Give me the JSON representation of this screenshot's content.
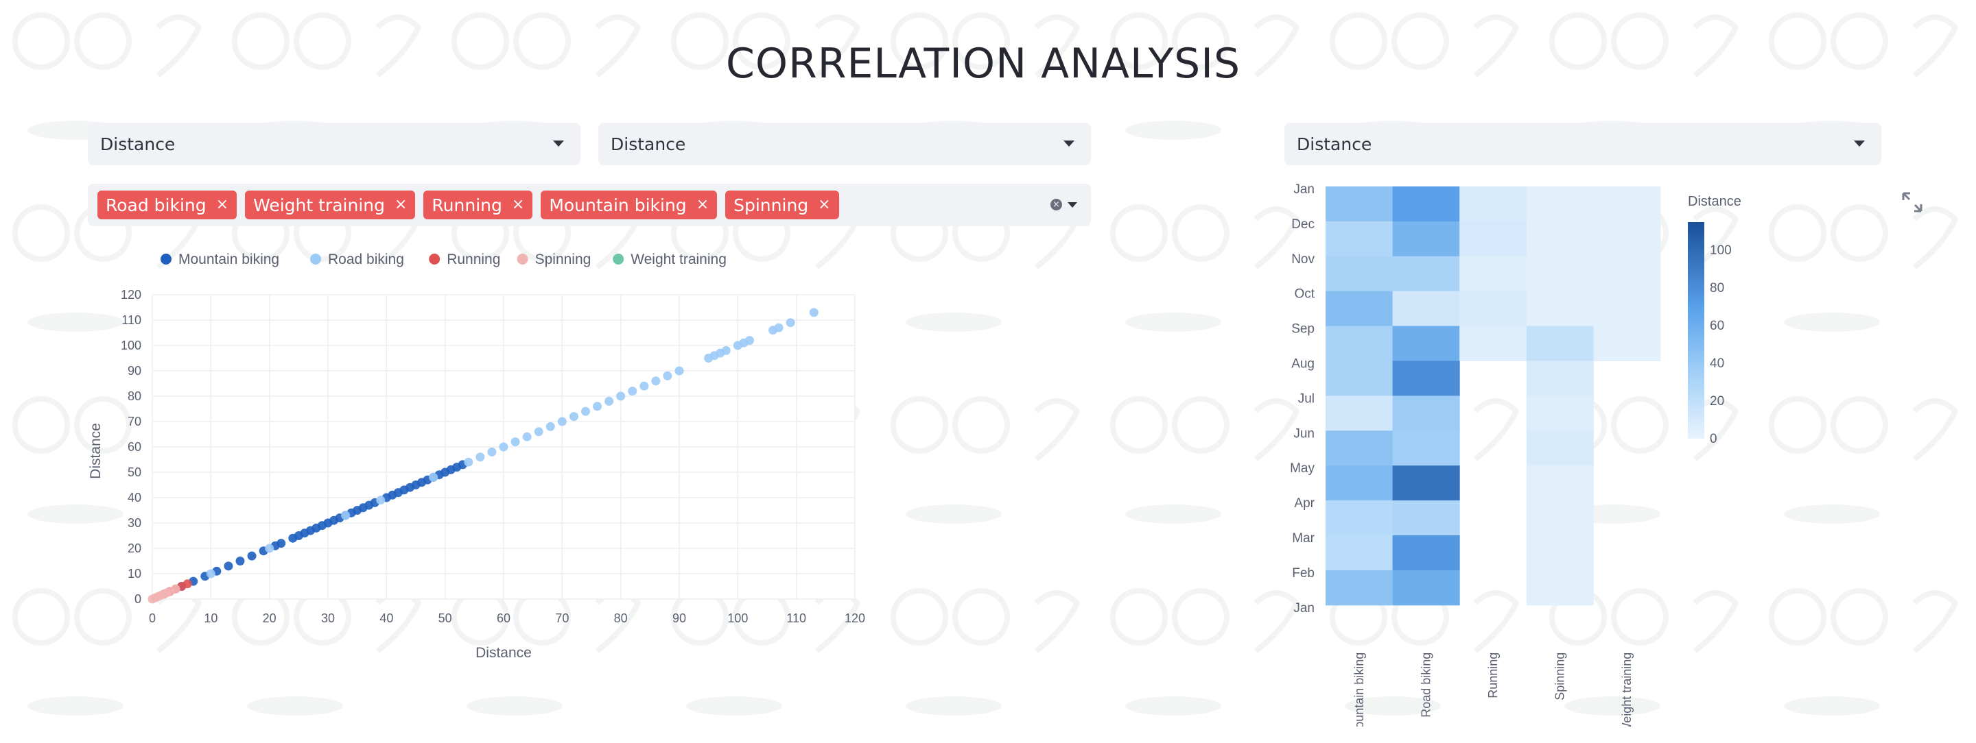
{
  "page": {
    "title": "CORRELATION ANALYSIS"
  },
  "controls": {
    "x_metric": "Distance",
    "y_metric": "Distance",
    "heatmap_metric": "Distance",
    "selected_sports": [
      "Road biking",
      "Weight training",
      "Running",
      "Mountain biking",
      "Spinning"
    ],
    "remove_glyph": "×"
  },
  "colors": {
    "Mountain biking": "#1e5fbf",
    "Road biking": "#9ccaf7",
    "Running": "#e05252",
    "Spinning": "#f2b3b3",
    "Weight training": "#6cc7a9"
  },
  "chart_data": [
    {
      "type": "scatter",
      "title": "",
      "xlabel": "Distance",
      "ylabel": "Distance",
      "xlim": [
        0,
        120
      ],
      "ylim": [
        0,
        120
      ],
      "x_ticks": [
        0,
        10,
        20,
        30,
        40,
        50,
        60,
        70,
        80,
        90,
        100,
        110,
        120
      ],
      "y_ticks": [
        0,
        10,
        20,
        30,
        40,
        50,
        60,
        70,
        80,
        90,
        100,
        110,
        120
      ],
      "grid": true,
      "legend_position": "top",
      "series": [
        {
          "name": "Mountain biking",
          "x": [
            3,
            5,
            7,
            9,
            11,
            13,
            15,
            17,
            19,
            21,
            22,
            24,
            25,
            26,
            27,
            28,
            29,
            30,
            31,
            32,
            33,
            34,
            35,
            36,
            37,
            38,
            40,
            41,
            42,
            43,
            44,
            45,
            46,
            47,
            48,
            49,
            50,
            51,
            52,
            53
          ],
          "y": [
            3,
            5,
            7,
            9,
            11,
            13,
            15,
            17,
            19,
            21,
            22,
            24,
            25,
            26,
            27,
            28,
            29,
            30,
            31,
            32,
            33,
            34,
            35,
            36,
            37,
            38,
            40,
            41,
            42,
            43,
            44,
            45,
            46,
            47,
            48,
            49,
            50,
            51,
            52,
            53
          ]
        },
        {
          "name": "Road biking",
          "x": [
            10,
            20,
            33,
            39,
            48,
            54,
            56,
            58,
            60,
            62,
            64,
            66,
            68,
            70,
            72,
            74,
            76,
            78,
            80,
            82,
            84,
            86,
            88,
            90,
            95,
            96,
            97,
            98,
            100,
            101,
            102,
            106,
            107,
            109,
            113
          ],
          "y": [
            10,
            20,
            33,
            39,
            48,
            54,
            56,
            58,
            60,
            62,
            64,
            66,
            68,
            70,
            72,
            74,
            76,
            78,
            80,
            82,
            84,
            86,
            88,
            90,
            95,
            96,
            97,
            98,
            100,
            101,
            102,
            106,
            107,
            109,
            113
          ]
        },
        {
          "name": "Running",
          "x": [
            2,
            3,
            4,
            5,
            6
          ],
          "y": [
            2,
            3,
            4,
            5,
            6
          ]
        },
        {
          "name": "Spinning",
          "x": [
            0,
            0.5,
            1,
            1.5,
            2,
            2.5,
            3,
            4
          ],
          "y": [
            0,
            0.5,
            1,
            1.5,
            2,
            2.5,
            3,
            4
          ]
        },
        {
          "name": "Weight training",
          "x": [],
          "y": []
        }
      ]
    },
    {
      "type": "heatmap",
      "title": "",
      "x_categories": [
        "Mountain biking",
        "Road biking",
        "Running",
        "Spinning",
        "Weight training"
      ],
      "y_categories": [
        "Jan",
        "Dec",
        "Nov",
        "Oct",
        "Sep",
        "Aug",
        "Jul",
        "Jun",
        "May",
        "Apr",
        "Mar",
        "Feb",
        "Jan"
      ],
      "values": [
        [
          45,
          70,
          8,
          3,
          3
        ],
        [
          28,
          55,
          10,
          3,
          3
        ],
        [
          32,
          32,
          6,
          3,
          3
        ],
        [
          48,
          12,
          8,
          3,
          3
        ],
        [
          32,
          60,
          5,
          18,
          3
        ],
        [
          32,
          80,
          null,
          8,
          null
        ],
        [
          12,
          38,
          null,
          5,
          null
        ],
        [
          45,
          35,
          null,
          8,
          null
        ],
        [
          50,
          95,
          null,
          3,
          null
        ],
        [
          25,
          30,
          null,
          3,
          null
        ],
        [
          22,
          75,
          null,
          3,
          null
        ],
        [
          45,
          60,
          null,
          3,
          null
        ]
      ],
      "colorbar": {
        "title": "Distance",
        "ticks": [
          0,
          20,
          40,
          60,
          80,
          100
        ],
        "range": [
          0,
          115
        ]
      }
    }
  ]
}
